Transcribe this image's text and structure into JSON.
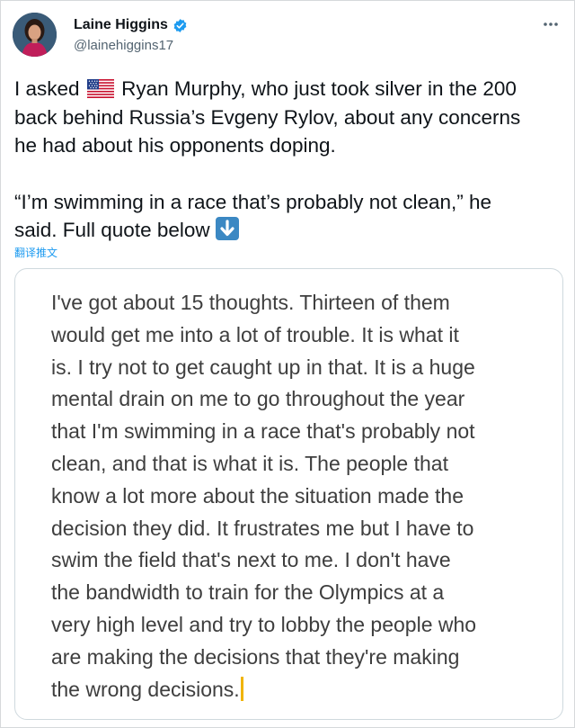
{
  "author": {
    "display_name": "Laine Higgins",
    "handle": "@lainehiggins17",
    "verified": true,
    "avatar_icon": "profile-photo"
  },
  "tweet": {
    "line1_prefix": "I asked",
    "flag_icon": "us-flag-emoji",
    "line1_rest": "Ryan Murphy, who just took silver in the 200",
    "line2": "back behind Russia’s Evgeny Rylov, about any concerns",
    "line3": "he had about his opponents doping.",
    "line4": "“I’m swimming in a race that’s probably not clean,” he",
    "line5": "said. Full quote below",
    "arrow_icon": "down-arrow-emoji"
  },
  "translate_label": "翻译推文",
  "quote_image": {
    "lines": [
      "I've got about 15 thoughts. Thirteen of them",
      "would get me into a lot of trouble. It is what it",
      "is. I try not to get caught up in that. It is a huge",
      "mental drain on me to go throughout the year",
      "that I'm swimming in a race that's probably not",
      "clean, and that is what it is. The people that",
      "know a lot more about the situation made the",
      "decision they did. It frustrates me but I have to",
      "swim the field that's next to me. I don't have",
      "the bandwidth to train for the Olympics at a",
      "very high level and try to lobby the people who",
      "are making the decisions that they're making",
      "the wrong decisions."
    ]
  },
  "colors": {
    "link": "#1d9bf0",
    "handle": "#536471",
    "verified": "#1d9bf0",
    "cursor": "#f0b400"
  }
}
